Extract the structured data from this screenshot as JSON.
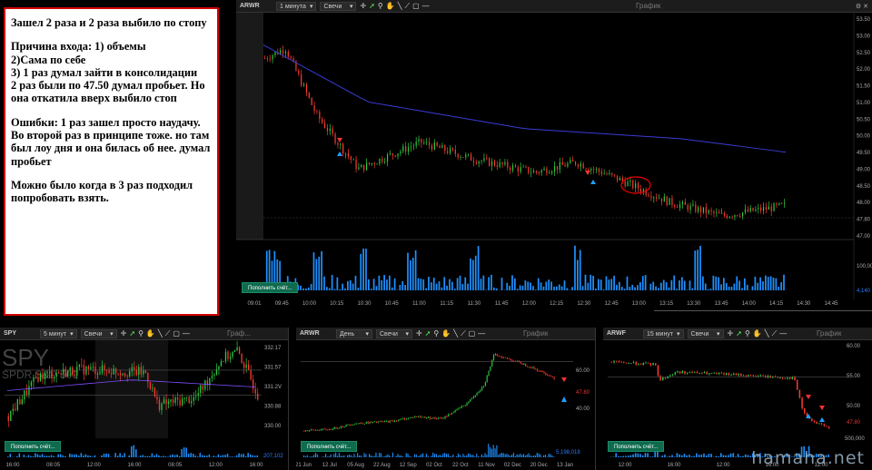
{
  "note": {
    "lines": [
      "Зашел 2 раза и 2 раза выбило по стопу",
      "",
      "Причина входа: 1) объемы",
      "2)Сама по себе",
      "3) 1 раз думал зайти в консолидации",
      "2 раз  были по 47.50 думал пробьет. Но она откатила вверх выбило стоп",
      "",
      "Ошибки: 1 раз зашел просто наудачу. Во второй раз в принципе тоже. но там был лоу дня и она билась об нее. думал пробьет",
      "",
      "Можно было когда в 3 раз подходил попробовать взять."
    ]
  },
  "main_chart": {
    "symbol": "ARWR",
    "interval": "1 минута",
    "type": "Свечи",
    "title": "График",
    "y_ticks": [
      "53.50",
      "53.00",
      "52.50",
      "52.00",
      "51.50",
      "51.00",
      "50.50",
      "50.00",
      "49.50",
      "49.00",
      "48.50",
      "48.00",
      "47.80",
      "47.00"
    ],
    "vol_ticks": [
      "100,000",
      "4,140"
    ],
    "x_ticks": [
      "09:01",
      "09:45",
      "10:00",
      "10:15",
      "10:30",
      "10:45",
      "11:00",
      "11:15",
      "11:30",
      "11:45",
      "12:00",
      "12:15",
      "12:30",
      "12:45",
      "13:00",
      "13:15",
      "13:30",
      "13:45",
      "14:00",
      "14:15",
      "14:30",
      "14:45"
    ],
    "button": "Пополнить счёт..."
  },
  "spy_chart": {
    "symbol": "SPY",
    "interval": "5 минут",
    "type": "Свечи",
    "title": "Граф...",
    "watermark_symbol": "SPY",
    "watermark_name": "SPDR S&P 500",
    "y_ticks": [
      "332.17",
      "331.57",
      "331.2V",
      "330.88",
      "330.00"
    ],
    "vol_tick": "207,102",
    "x_ticks": [
      "16:00",
      "08:05",
      "12:00",
      "16:00",
      "08:05",
      "12:00",
      "16:00"
    ],
    "button": "Пополнить счёт..."
  },
  "daily_chart": {
    "symbol": "ARWR",
    "interval": "День",
    "type": "Свечи",
    "title": "График",
    "y_ticks": [
      "60.00",
      "47.80",
      "40.00"
    ],
    "vol_tick": "5,198,018",
    "x_ticks": [
      "21 Jun",
      "12 Jul",
      "05 Aug",
      "22 Aug",
      "12 Sep",
      "02 Oct",
      "22 Oct",
      "11 Nov",
      "02 Dec",
      "20 Dec",
      "13 Jan"
    ],
    "button": "Пополнить счёт..."
  },
  "m15_chart": {
    "symbol": "ARWF",
    "interval": "15 минут",
    "type": "Свечи",
    "title": "График",
    "y_ticks": [
      "60.00",
      "55.00",
      "50.00",
      "47.80"
    ],
    "vol_tick": "500,000",
    "x_ticks": [
      "12:00",
      "16:00",
      "12:00",
      "16:00",
      "12:00"
    ],
    "button": "Пополнить счёт..."
  },
  "watermark": "hamaha.net",
  "colors": {
    "up": "#2ecc40",
    "down": "#ff3b30",
    "volume": "#1e90ff",
    "ma": "#3b3bd6",
    "note_border": "#d40000",
    "button": "#0f6b4e"
  }
}
